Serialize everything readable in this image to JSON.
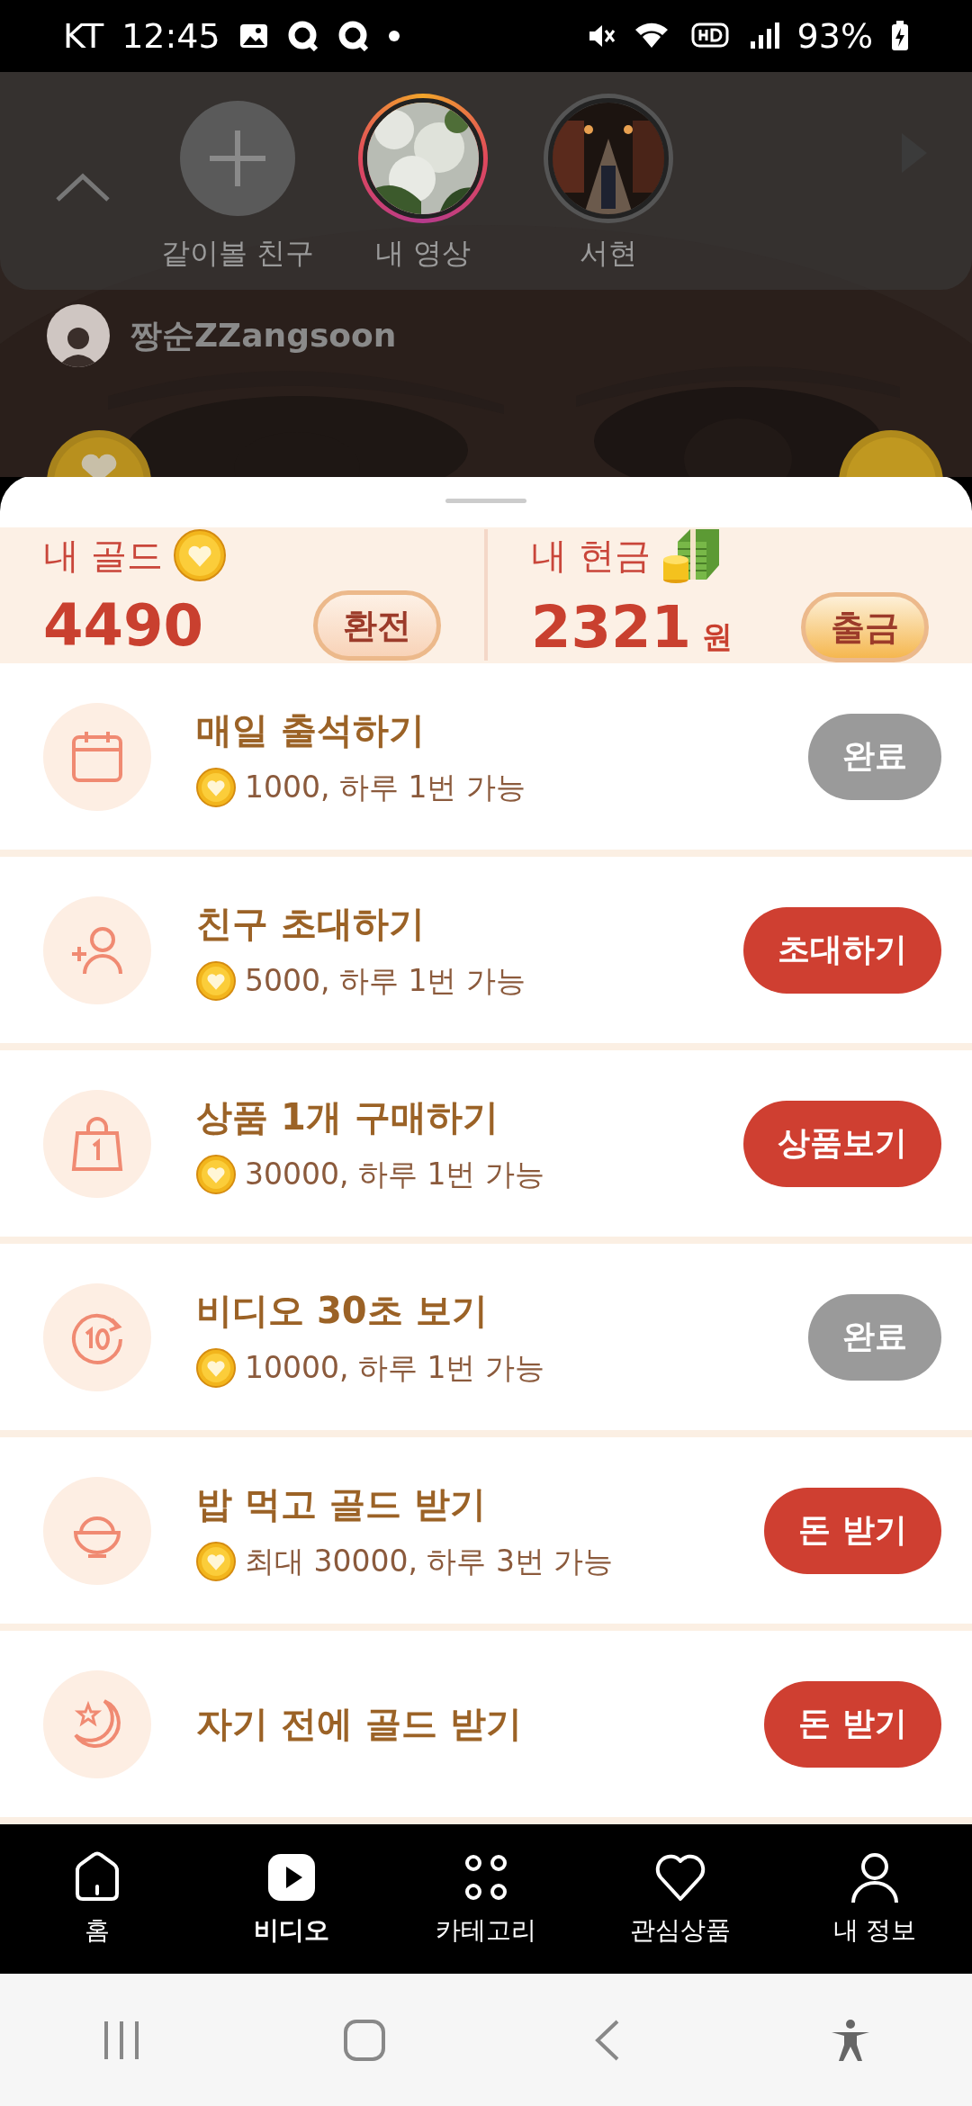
{
  "status_bar": {
    "carrier": "KT",
    "time": "12:45",
    "battery": "93%"
  },
  "friends_panel": {
    "items": [
      {
        "kind": "add",
        "label": "같이볼 친구"
      },
      {
        "kind": "mine",
        "label": "내 영상"
      },
      {
        "kind": "friend",
        "label": "서현"
      }
    ]
  },
  "video": {
    "author": "짱순ZZangsoon"
  },
  "wallet": {
    "gold": {
      "label": "내 골드",
      "amount": "4490",
      "button": "환전"
    },
    "cash": {
      "label": "내 현금",
      "amount": "2321",
      "unit": "원",
      "button": "출금"
    }
  },
  "missions": [
    {
      "kind": "calendar",
      "title": "매일 출석하기",
      "reward": "1000, 하루 1번 가능",
      "button": "완료",
      "done": true
    },
    {
      "kind": "invite",
      "title": "친구 초대하기",
      "reward": "5000, 하루 1번 가능",
      "button": "초대하기",
      "done": false
    },
    {
      "kind": "bag",
      "title": "상품 1개 구매하기",
      "reward": "30000, 하루 1번 가능",
      "button": "상품보기",
      "done": false
    },
    {
      "kind": "timer",
      "title": "비디오 30초 보기",
      "reward": "10000, 하루 1번 가능",
      "button": "완료",
      "done": true
    },
    {
      "kind": "rice",
      "title": "밥 먹고 골드 받기",
      "reward": "최대 30000, 하루 3번 가능",
      "button": "돈 받기",
      "done": false
    },
    {
      "kind": "moon",
      "title": "자기 전에 골드 받기",
      "button": "돈 받기",
      "done": false
    }
  ],
  "nav": [
    {
      "kind": "home",
      "label": "홈",
      "selected": false
    },
    {
      "kind": "video",
      "label": "비디오",
      "selected": true
    },
    {
      "kind": "category",
      "label": "카테고리",
      "selected": false
    },
    {
      "kind": "heart",
      "label": "관심상품",
      "selected": false
    },
    {
      "kind": "person",
      "label": "내 정보",
      "selected": false
    }
  ]
}
